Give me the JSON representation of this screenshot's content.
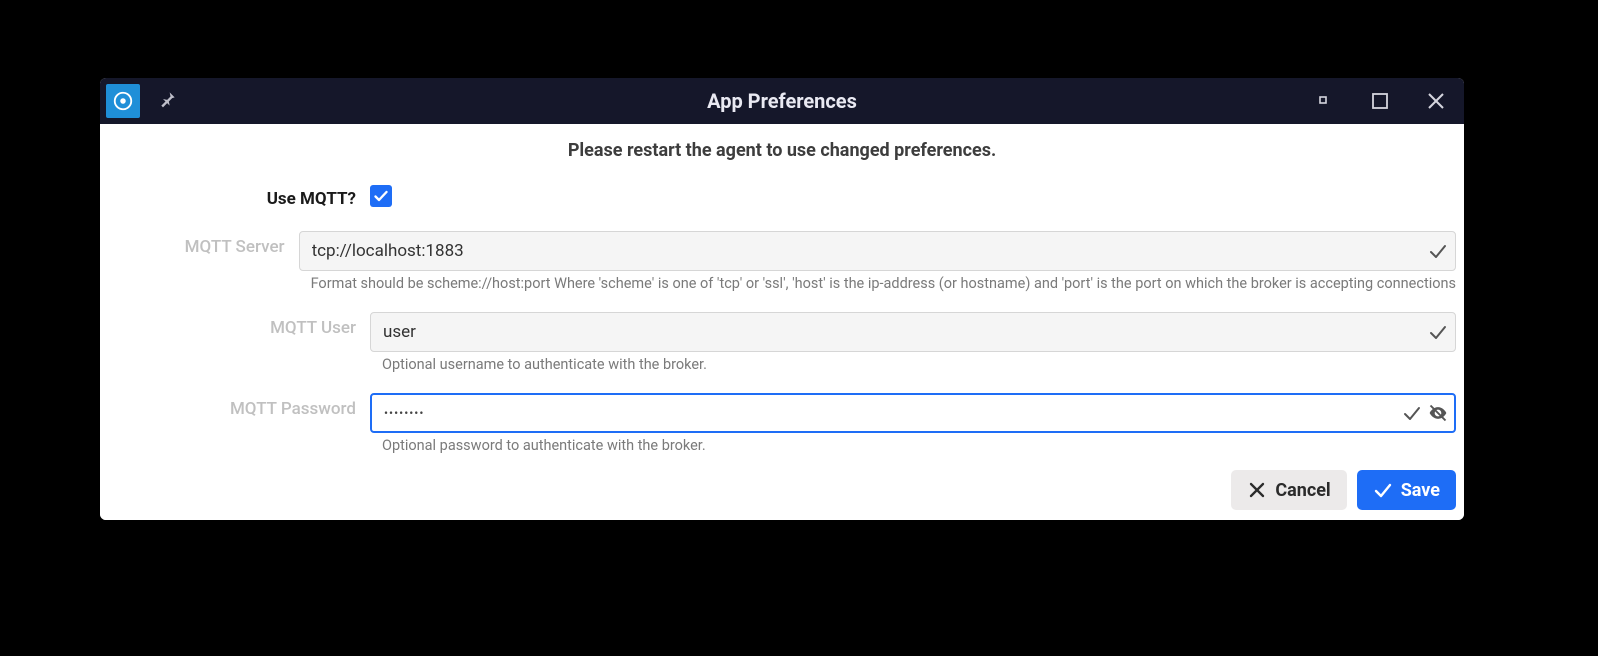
{
  "titlebar": {
    "title": "App Preferences"
  },
  "notice": "Please restart the agent to use changed preferences.",
  "form": {
    "use_mqtt": {
      "label": "Use MQTT?",
      "checked": true
    },
    "server": {
      "label": "MQTT Server",
      "value": "tcp://localhost:1883",
      "helper": "Format should be scheme://host:port Where 'scheme' is one of 'tcp' or 'ssl', 'host' is the ip-address (or hostname) and 'port' is the port on which the broker is accepting connections"
    },
    "user": {
      "label": "MQTT User",
      "value": "user",
      "helper": "Optional username to authenticate with the broker."
    },
    "password": {
      "label": "MQTT Password",
      "value": "••••••••",
      "helper": "Optional password to authenticate with the broker."
    }
  },
  "footer": {
    "cancel": "Cancel",
    "save": "Save"
  }
}
